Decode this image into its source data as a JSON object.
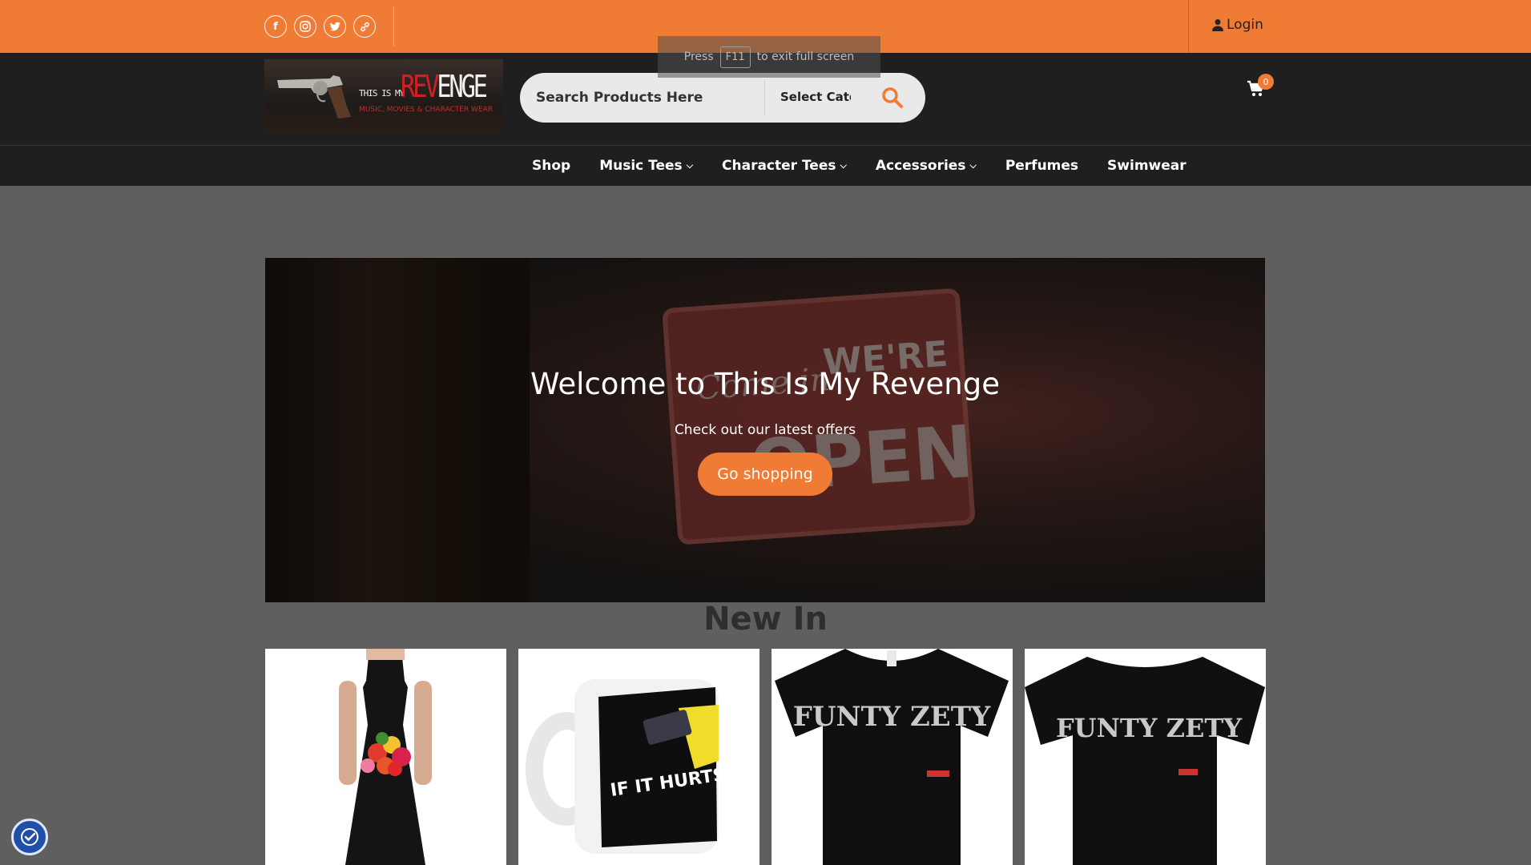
{
  "topbar": {
    "social_icons": [
      "facebook-icon",
      "instagram-icon",
      "twitter-icon",
      "link-icon"
    ],
    "login_label": "Login"
  },
  "fullscreen_hint": {
    "press": "Press",
    "key": "F11",
    "rest": "to exit full screen"
  },
  "header": {
    "logo": {
      "small_text": "THIS IS MY",
      "big_red": "REV",
      "big_white": "ENGE",
      "tagline": "MUSIC, MOVIES & CHARACTER WEAR"
    },
    "search": {
      "placeholder": "Search Products Here",
      "category": "Select Category"
    },
    "cart_count": "0"
  },
  "nav": {
    "items": [
      {
        "label": "Shop",
        "dropdown": false
      },
      {
        "label": "Music Tees",
        "dropdown": true
      },
      {
        "label": "Character Tees",
        "dropdown": true
      },
      {
        "label": "Accessories",
        "dropdown": true
      },
      {
        "label": "Perfumes",
        "dropdown": false
      },
      {
        "label": "Swimwear",
        "dropdown": false
      }
    ]
  },
  "hero": {
    "title": "Welcome to This Is My Revenge",
    "subtitle": "Check out our latest offers",
    "button": "Go shopping",
    "sign_line1": "Come in",
    "sign_line2": "WE'RE",
    "sign_line3": "OPEN"
  },
  "section_title": "New In",
  "products": [
    {
      "kind": "dress",
      "print": ""
    },
    {
      "kind": "mug",
      "print": "IF IT HURTS YOU MORE YOU'RE PROBABLY HO"
    },
    {
      "kind": "tshirt",
      "print": "FUNTY ZETY"
    },
    {
      "kind": "tshirt",
      "print": "FUNTY ZETY"
    }
  ],
  "colors": {
    "accent": "#ef7b34",
    "header_bg": "#1f1f1f",
    "page_bg": "#5f5f5f"
  }
}
